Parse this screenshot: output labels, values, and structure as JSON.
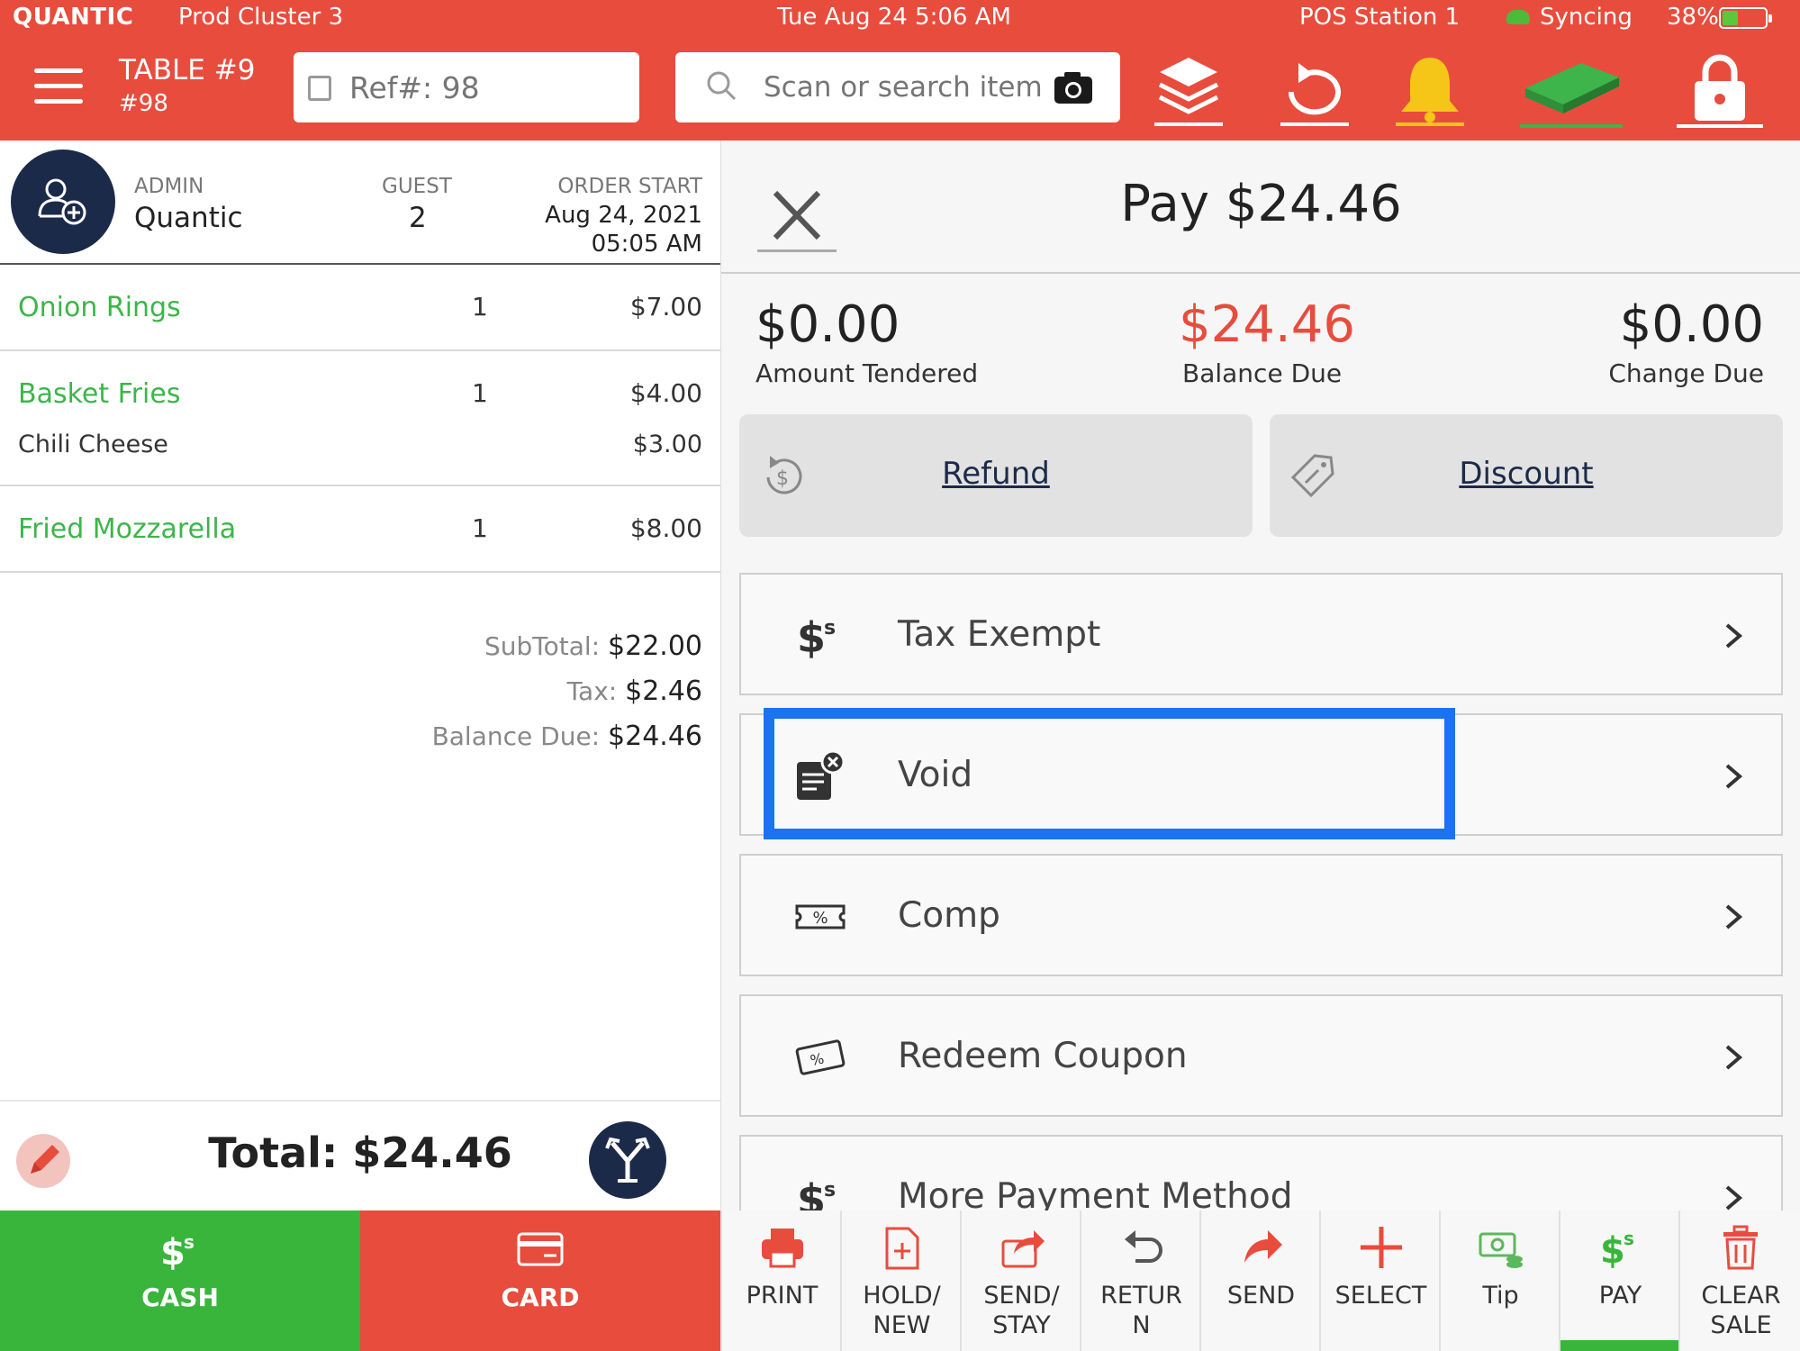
{
  "status_bar": {
    "brand": "QUANTIC",
    "cluster": "Prod Cluster 3",
    "datetime": "Tue Aug 24 5:06 AM",
    "station": "POS Station 1",
    "sync_status": "Syncing",
    "battery_pct": "38%",
    "battery_level": 0.38
  },
  "header": {
    "table_title": "TABLE #9",
    "table_sub": "#98",
    "ref_placeholder": "Ref#: 98",
    "search_placeholder": "Scan or search item",
    "icons": [
      "menu-icon",
      "layers-icon",
      "sync-icon",
      "bell-icon",
      "cash-drawer-icon",
      "lock-icon"
    ]
  },
  "order": {
    "role": "ADMIN",
    "customer": "Quantic",
    "guest_label": "GUEST",
    "guest_count": "2",
    "order_start_label": "ORDER START",
    "order_date": "Aug 24, 2021",
    "order_time": "05:05 AM",
    "items": [
      {
        "name": "Onion Rings",
        "qty": "1",
        "price": "$7.00"
      },
      {
        "name": "Basket Fries",
        "qty": "1",
        "price": "$4.00",
        "modifier": "Chili Cheese",
        "modifier_price": "$3.00"
      },
      {
        "name": "Fried Mozzarella",
        "qty": "1",
        "price": "$8.00"
      }
    ],
    "subtotal_label": "SubTotal:",
    "subtotal": "$22.00",
    "tax_label": "Tax:",
    "tax": "$2.46",
    "balance_label": "Balance Due:",
    "balance": "$24.46",
    "total_text": "Total: $24.46"
  },
  "payment": {
    "title": "Pay $24.46",
    "amount_tendered": "$0.00",
    "amount_tendered_label": "Amount Tendered",
    "balance_due": "$24.46",
    "balance_due_label": "Balance Due",
    "change_due": "$0.00",
    "change_due_label": "Change Due",
    "refund_label": "Refund",
    "discount_label": "Discount",
    "options": [
      {
        "label": "Tax Exempt",
        "icon": "dollar-tax-icon"
      },
      {
        "label": "Void",
        "icon": "void-document-icon"
      },
      {
        "label": "Comp",
        "icon": "comp-ticket-icon"
      },
      {
        "label": "Redeem Coupon",
        "icon": "coupon-icon"
      },
      {
        "label": "More Payment Method",
        "icon": "dollar-payment-icon"
      }
    ]
  },
  "toolbar": {
    "cash": "CASH",
    "card": "CARD",
    "print": "PRINT",
    "hold_1": "HOLD/",
    "hold_2": "NEW",
    "sendstay_1": "SEND/",
    "sendstay_2": "STAY",
    "return_1": "RETUR",
    "return_2": "N",
    "send": "SEND",
    "select": "SELECT",
    "tip": "Tip",
    "pay": "PAY",
    "clear_1": "CLEAR",
    "clear_2": "SALE"
  },
  "colors": {
    "header_red": "#e84c3d",
    "item_green": "#3db54a",
    "cash_green": "#39b53c",
    "navy": "#1c2a4a",
    "highlight_blue": "#1a73f0"
  }
}
